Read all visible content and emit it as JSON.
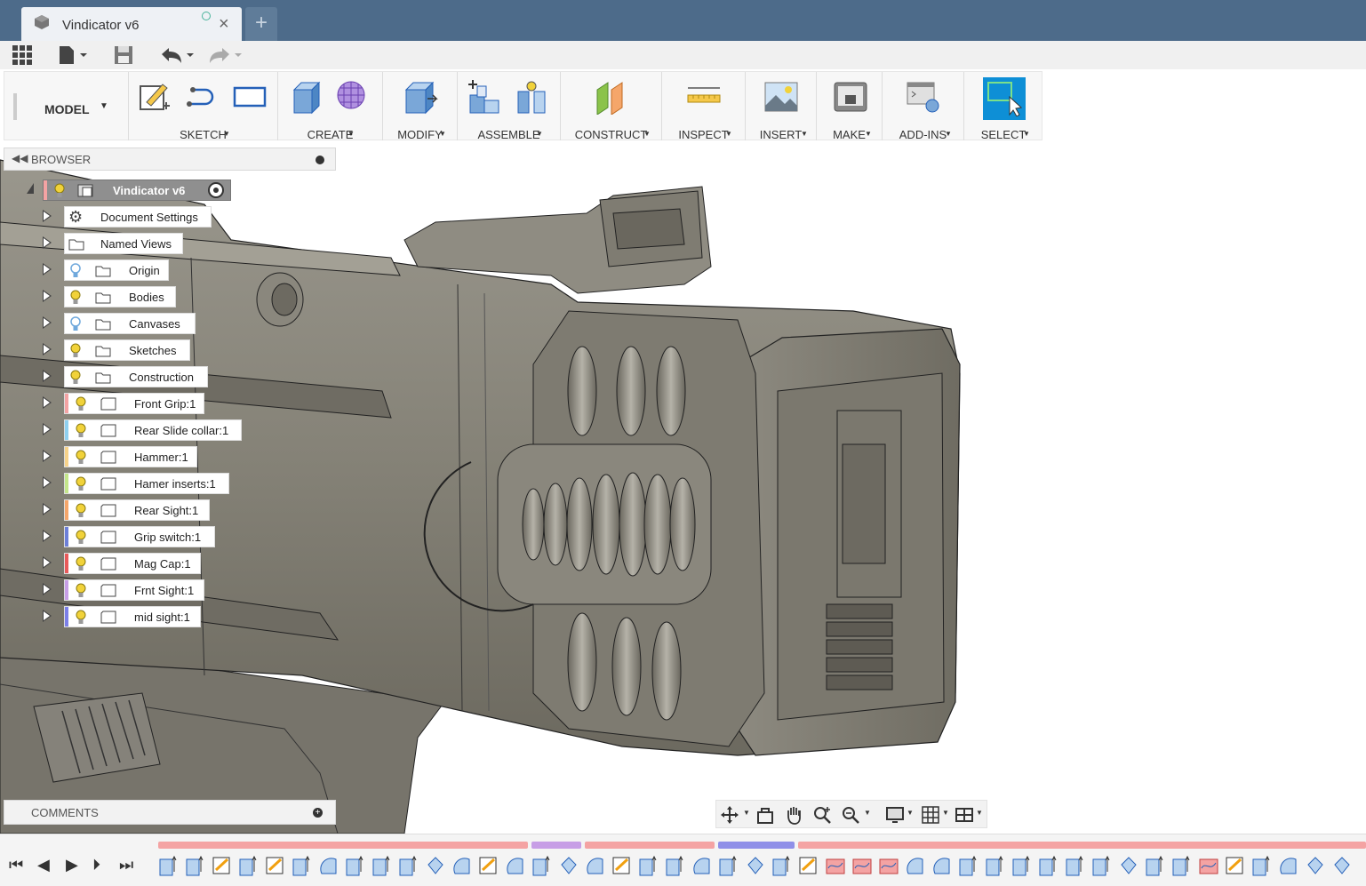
{
  "window": {
    "doc_title": "Vindicator v6"
  },
  "ribbon": {
    "workspace": "MODEL",
    "groups": [
      {
        "label": "SKETCH"
      },
      {
        "label": "CREATE"
      },
      {
        "label": "MODIFY"
      },
      {
        "label": "ASSEMBLE"
      },
      {
        "label": "CONSTRUCT"
      },
      {
        "label": "INSPECT"
      },
      {
        "label": "INSERT"
      },
      {
        "label": "MAKE"
      },
      {
        "label": "ADD-INS"
      },
      {
        "label": "SELECT"
      }
    ]
  },
  "browser": {
    "header": "BROWSER",
    "root": "Vindicator v6",
    "items": [
      {
        "label": "Document Settings",
        "icon": "gear-icon"
      },
      {
        "label": "Named Views",
        "icon": "folder-icon"
      },
      {
        "label": "Origin",
        "icon": "folder-icon",
        "bulb": "#6fa8dc"
      },
      {
        "label": "Bodies",
        "icon": "folder-icon",
        "bulb": "#f1d23a"
      },
      {
        "label": "Canvases",
        "icon": "folder-icon",
        "bulb": "#6fa8dc"
      },
      {
        "label": "Sketches",
        "icon": "folder-icon",
        "bulb": "#f1d23a"
      },
      {
        "label": "Construction",
        "icon": "folder-icon",
        "bulb": "#f1d23a"
      },
      {
        "label": "Front Grip:1",
        "icon": "component-icon",
        "color": "#f4a3a3"
      },
      {
        "label": "Rear Slide collar:1",
        "icon": "component-icon",
        "color": "#8fd0f0"
      },
      {
        "label": "Hammer:1",
        "icon": "component-icon",
        "color": "#f7d38a"
      },
      {
        "label": "Hamer inserts:1",
        "icon": "component-icon",
        "color": "#c4e68a"
      },
      {
        "label": "Rear Sight:1",
        "icon": "component-icon",
        "color": "#f5a66a"
      },
      {
        "label": "Grip switch:1",
        "icon": "component-icon",
        "color": "#6c7fd8"
      },
      {
        "label": "Mag Cap:1",
        "icon": "component-icon",
        "color": "#e85a5a"
      },
      {
        "label": "Frnt Sight:1",
        "icon": "component-icon",
        "color": "#c79ee6"
      },
      {
        "label": "mid sight:1",
        "icon": "component-icon",
        "color": "#7b7fe8"
      }
    ]
  },
  "comments": {
    "header": "COMMENTS"
  },
  "colors": {
    "title_bar": "#4d6b8a",
    "select_accent": "#0e8fd6",
    "model_shade": "#8d8a80"
  }
}
